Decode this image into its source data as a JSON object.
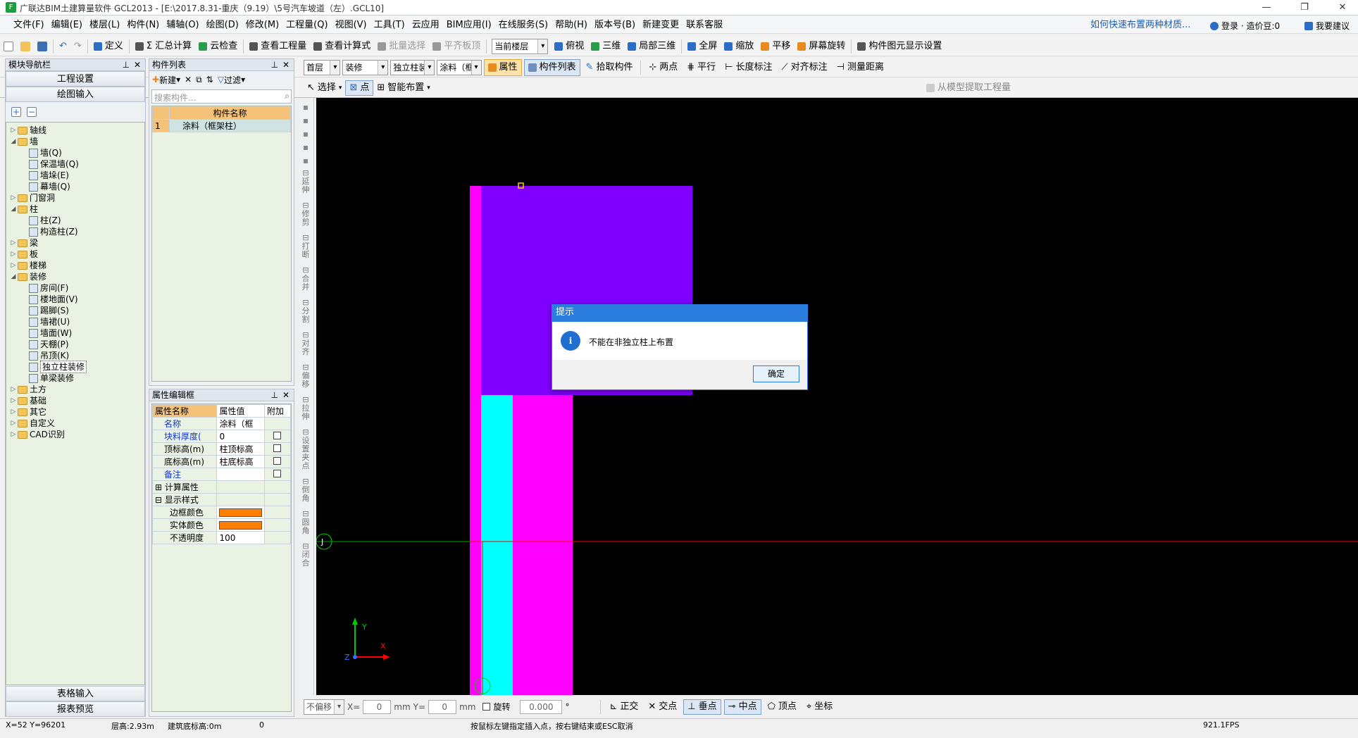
{
  "title": "广联达BIM土建算量软件 GCL2013 - [E:\\2017.8.31-重庆（9.19）\\5号汽车坡道（左）.GCL10]",
  "menu": [
    "文件(F)",
    "编辑(E)",
    "楼层(L)",
    "构件(N)",
    "辅轴(O)",
    "绘图(D)",
    "修改(M)",
    "工程量(Q)",
    "视图(V)",
    "工具(T)",
    "云应用",
    "BIM应用(I)",
    "在线服务(S)",
    "帮助(H)",
    "版本号(B)",
    "新建变更",
    "联系客服"
  ],
  "menu_right": {
    "help_link": "如何快速布置两种材质...",
    "login": "登录 · 造价豆:0",
    "suggest": "我要建议"
  },
  "toolbar1": [
    "定义",
    "Σ 汇总计算",
    "云检查",
    "查看工程量",
    "查看计算式",
    "批量选择",
    "平齐板顶",
    "当前楼层",
    "俯视",
    "三维",
    "局部三维",
    "全屏",
    "缩放",
    "平移",
    "屏幕旋转",
    "构件图元显示设置"
  ],
  "toolbar2": {
    "floor": "首层",
    "category": "装修",
    "type": "独立柱装",
    "item": "涂料（框",
    "attr": "属性",
    "list": "构件列表",
    "pick": "拾取构件",
    "twopoint": "两点",
    "parallel": "平行",
    "length_mark": "长度标注",
    "align_mark": "对齐标注",
    "measure": "测量距离"
  },
  "toolbar3": {
    "select": "选择",
    "point": "点",
    "smart": "智能布置",
    "extract": "从模型提取工程量"
  },
  "nav": {
    "title": "模块导航栏",
    "proj_settings": "工程设置",
    "draw_input": "绘图输入",
    "table_input": "表格输入",
    "report": "报表预览"
  },
  "tree": [
    {
      "label": "轴线",
      "lvl": 0,
      "kind": "folder",
      "open": false
    },
    {
      "label": "墙",
      "lvl": 0,
      "kind": "folder",
      "open": true
    },
    {
      "label": "墙(Q)",
      "lvl": 1,
      "kind": "item"
    },
    {
      "label": "保温墙(Q)",
      "lvl": 1,
      "kind": "item"
    },
    {
      "label": "墙垛(E)",
      "lvl": 1,
      "kind": "item"
    },
    {
      "label": "幕墙(Q)",
      "lvl": 1,
      "kind": "item"
    },
    {
      "label": "门窗洞",
      "lvl": 0,
      "kind": "folder",
      "open": false
    },
    {
      "label": "柱",
      "lvl": 0,
      "kind": "folder",
      "open": true
    },
    {
      "label": "柱(Z)",
      "lvl": 1,
      "kind": "item"
    },
    {
      "label": "构造柱(Z)",
      "lvl": 1,
      "kind": "item"
    },
    {
      "label": "梁",
      "lvl": 0,
      "kind": "folder",
      "open": false
    },
    {
      "label": "板",
      "lvl": 0,
      "kind": "folder",
      "open": false
    },
    {
      "label": "楼梯",
      "lvl": 0,
      "kind": "folder",
      "open": false
    },
    {
      "label": "装修",
      "lvl": 0,
      "kind": "folder",
      "open": true
    },
    {
      "label": "房间(F)",
      "lvl": 1,
      "kind": "item"
    },
    {
      "label": "楼地面(V)",
      "lvl": 1,
      "kind": "item"
    },
    {
      "label": "踢脚(S)",
      "lvl": 1,
      "kind": "item"
    },
    {
      "label": "墙裙(U)",
      "lvl": 1,
      "kind": "item"
    },
    {
      "label": "墙面(W)",
      "lvl": 1,
      "kind": "item"
    },
    {
      "label": "天棚(P)",
      "lvl": 1,
      "kind": "item"
    },
    {
      "label": "吊顶(K)",
      "lvl": 1,
      "kind": "item"
    },
    {
      "label": "独立柱装修",
      "lvl": 1,
      "kind": "item",
      "selected": true
    },
    {
      "label": "单梁装修",
      "lvl": 1,
      "kind": "item"
    },
    {
      "label": "土方",
      "lvl": 0,
      "kind": "folder",
      "open": false
    },
    {
      "label": "基础",
      "lvl": 0,
      "kind": "folder",
      "open": false
    },
    {
      "label": "其它",
      "lvl": 0,
      "kind": "folder",
      "open": false
    },
    {
      "label": "自定义",
      "lvl": 0,
      "kind": "folder",
      "open": false
    },
    {
      "label": "CAD识别",
      "lvl": 0,
      "kind": "folder",
      "open": false
    }
  ],
  "comp_list": {
    "title": "构件列表",
    "new": "新建",
    "filter": "过滤",
    "search_placeholder": "搜索构件...",
    "col": "构件名称",
    "rows": [
      {
        "idx": "1",
        "name": "涂料（框架柱）"
      }
    ]
  },
  "props": {
    "title": "属性编辑框",
    "cols": [
      "属性名称",
      "属性值",
      "附加"
    ],
    "rows": [
      {
        "name": "名称",
        "val": "涂料（框",
        "chk": false,
        "blue": true
      },
      {
        "name": "块料厚度(",
        "val": "0",
        "chk": true,
        "blue": true
      },
      {
        "name": "顶标高(m)",
        "val": "柱顶标高",
        "chk": true,
        "blue": false
      },
      {
        "name": "底标高(m)",
        "val": "柱底标高",
        "chk": true,
        "blue": false
      },
      {
        "name": "备注",
        "val": "",
        "chk": true,
        "blue": true
      }
    ],
    "group1": "计算属性",
    "group2": "显示样式",
    "style": [
      {
        "name": "边框颜色",
        "color": "#ff8000"
      },
      {
        "name": "实体颜色",
        "color": "#ff8000"
      },
      {
        "name": "不透明度",
        "val": "100"
      }
    ]
  },
  "side_tools": [
    "延伸",
    "修剪",
    "打断",
    "合并",
    "分割",
    "对齐",
    "偏移",
    "拉伸",
    "设置夹点",
    "倒角",
    "圆角",
    "闭合"
  ],
  "canvas": {
    "axis_label": "J",
    "y_label": "Y",
    "x_label": "X",
    "z_label": "Z"
  },
  "dialog": {
    "title": "提示",
    "message": "不能在非独立柱上布置",
    "ok": "确定"
  },
  "snapbar": {
    "offset": "不偏移",
    "x_label": "X=",
    "x_val": "0",
    "mm": "mm",
    "y_label": "Y=",
    "y_val": "0",
    "mm2": "mm",
    "rotate": "旋转",
    "angle": "0.000",
    "deg": "°",
    "ortho": "正交",
    "intersect": "交点",
    "perp": "垂点",
    "mid": "中点",
    "vertex": "顶点",
    "coord": "坐标"
  },
  "status": {
    "xy": "X=52 Y=96201",
    "floor_h": "层高:2.93m",
    "base": "建筑底标高:0m",
    "zero": "0",
    "hint": "按鼠标左键指定插入点，按右键结束或ESC取消",
    "fps": "921.1FPS"
  }
}
